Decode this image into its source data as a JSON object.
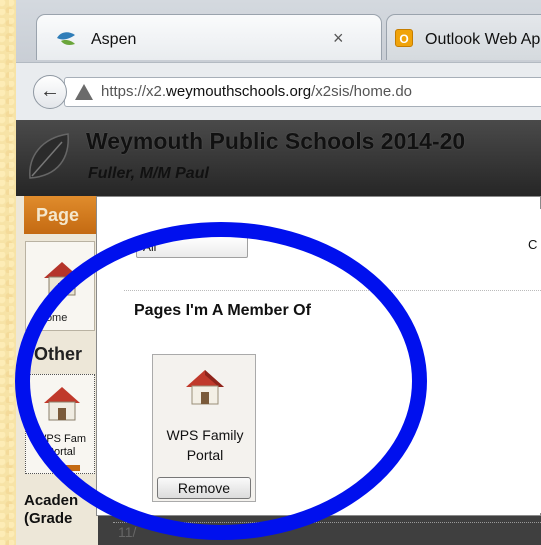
{
  "browser": {
    "tabs": [
      {
        "title": "Aspen",
        "close": "×",
        "active": true
      },
      {
        "title": "Outlook Web Ap",
        "icon_letter": "O",
        "active": false
      }
    ],
    "back_arrow": "←",
    "url_prefix": "https://x2.",
    "url_domain": "weymouthschools.org",
    "url_path": "/x2sis/home.do"
  },
  "header": {
    "title": "Weymouth Public Schools 2014-20",
    "user": "Fuller, M/M Paul"
  },
  "left_panel": {
    "pages_tab": "Page",
    "home_label": "Home",
    "others_label": "Other",
    "wps_label_line1": "WPS Fam",
    "wps_label_line2": "Portal",
    "academic_line1": "Acaden",
    "academic_line2": "(Grade"
  },
  "dialog": {
    "filter_value": "All",
    "c_label": "C",
    "section_heading": "Pages I'm A Member Of",
    "card_name_line1": "WPS Family",
    "card_name_line2": "Portal",
    "remove_label": "Remove",
    "bottom_fragment": "11/"
  },
  "colors": {
    "highlight_ring": "#0010ee",
    "pages_tab": "#d67a1e",
    "background": "#f7e3a6"
  },
  "icons": [
    "aspen-leaf-icon",
    "outlook-icon",
    "close-icon",
    "back-arrow-icon",
    "warning-icon",
    "house-icon",
    "leaf-logo-icon"
  ]
}
